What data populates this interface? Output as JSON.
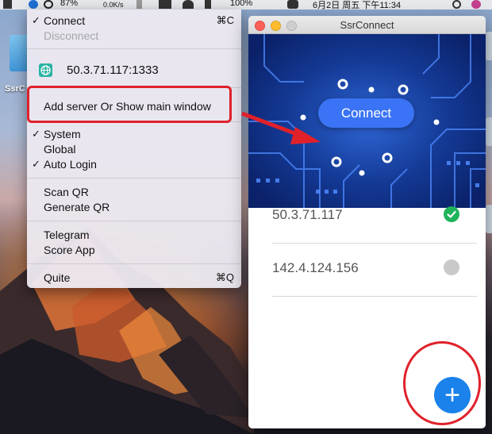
{
  "menubar": {
    "battery_percent": "87%",
    "net_speed_up": "0.0K/s",
    "net_speed_down": "0.0K/s",
    "battery_percent_2": "100%",
    "datetime": "6月2日 周五 下午11:34"
  },
  "desktop": {
    "icon_label": "SsrC"
  },
  "menu": {
    "connect_label": "Connect",
    "connect_shortcut": "⌘C",
    "disconnect_label": "Disconnect",
    "server_address": "50.3.71.117:1333",
    "add_server_label": "Add server Or Show main window",
    "system_label": "System",
    "global_label": "Global",
    "auto_login_label": "Auto Login",
    "scan_qr_label": "Scan QR",
    "generate_qr_label": "Generate QR",
    "telegram_label": "Telegram",
    "score_app_label": "Score App",
    "quit_label": "Quite",
    "quit_shortcut": "⌘Q"
  },
  "window": {
    "title": "SsrConnect",
    "connect_button": "Connect",
    "servers": [
      {
        "ip": "50.3.71.117",
        "status": "connected"
      },
      {
        "ip": "142.4.124.156",
        "status": "idle"
      }
    ],
    "add_button": "+"
  },
  "colors": {
    "accent_blue": "#3a73f5",
    "connected_green": "#1fb45a",
    "idle_gray": "#c9c9c9",
    "annotation_red": "#e0212a"
  }
}
